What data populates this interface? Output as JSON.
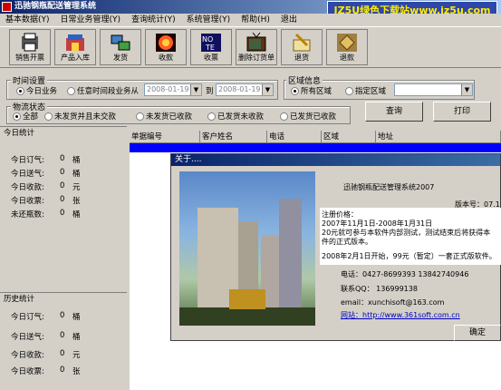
{
  "window": {
    "title": "迅驰钢瓶配送管理系统"
  },
  "brand": {
    "text": "JZ5U绿色下载站www.jz5u.com"
  },
  "menu": [
    "基本数据(Y)",
    "日常业务管理(Y)",
    "查询统计(Y)",
    "系统管理(Y)",
    "帮助(H)",
    "退出"
  ],
  "toolbar": [
    {
      "label": "销售开票",
      "icon": "invoice-icon"
    },
    {
      "label": "产品入库",
      "icon": "warehouse-icon"
    },
    {
      "label": "发货",
      "icon": "shipping-icon"
    },
    {
      "label": "收款",
      "icon": "collect-icon"
    },
    {
      "label": "收票",
      "icon": "note-icon"
    },
    {
      "label": "删除订货单",
      "icon": "tv-delete-icon"
    },
    {
      "label": "退货",
      "icon": "return-goods-icon"
    },
    {
      "label": "退款",
      "icon": "refund-icon"
    }
  ],
  "time_setting": {
    "legend": "时间设置",
    "opt_today": "今日业务",
    "opt_range": "任意时间段业务从",
    "date_from": "2008-01-19",
    "to_label": "到",
    "date_to": "2008-01-19"
  },
  "region_info": {
    "legend": "区域信息",
    "opt_all": "所有区域",
    "opt_specific": "指定区域"
  },
  "logistics": {
    "legend": "物流状态",
    "opts": [
      "全部",
      "未发货并且未交款",
      "未发货已收款",
      "已发货未收款",
      "已发货已收款"
    ]
  },
  "buttons": {
    "query": "查询",
    "print": "打印"
  },
  "today_stats": {
    "title": "今日统计",
    "rows": [
      {
        "label": "今日订气:",
        "value": "0",
        "unit": "桶"
      },
      {
        "label": "今日送气:",
        "value": "0",
        "unit": "桶"
      },
      {
        "label": "今日收款:",
        "value": "0",
        "unit": "元"
      },
      {
        "label": "今日收票:",
        "value": "0",
        "unit": "张"
      },
      {
        "label": "未还瓶数:",
        "value": "0",
        "unit": "桶"
      }
    ]
  },
  "history_stats": {
    "title": "历史统计",
    "rows": [
      {
        "label": "今日订气:",
        "value": "0",
        "unit": "桶"
      },
      {
        "label": "今日送气:",
        "value": "0",
        "unit": "桶"
      },
      {
        "label": "今日收款:",
        "value": "0",
        "unit": "元"
      },
      {
        "label": "今日收票:",
        "value": "0",
        "unit": "张"
      }
    ]
  },
  "table": {
    "columns": [
      "单据编号",
      "客户姓名",
      "电话",
      "区域",
      "地址"
    ]
  },
  "about": {
    "title": "关于....",
    "product": "迅驰钢瓶配送管理系统2007",
    "version": "版本号：07.1",
    "reg_price_label": "注册价格：",
    "reg_period": "2007年11月1日-2008年1月31日",
    "reg_line1": "20元就可参与本软件内部测试，测试结束后将获得本",
    "reg_line2": "件的正式版本。",
    "reg_line3": "2008年2月1日开始，99元（暂定）一套正式版软件。",
    "phone": "电话：0427-8699393   13842740946",
    "qq": "联系QQ：  136999138",
    "email": "email：xunchisoft@163.com",
    "website": "网站：http://www.361soft.com.cn",
    "ok": "确定"
  }
}
